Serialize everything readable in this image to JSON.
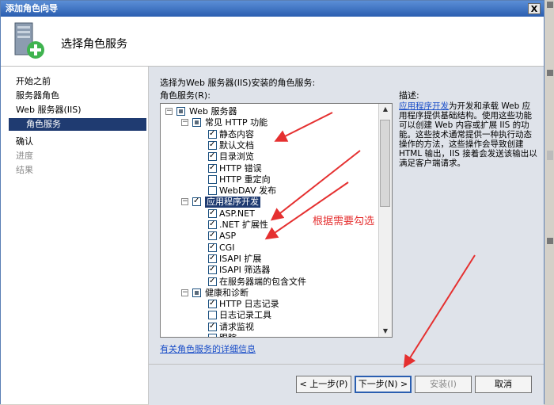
{
  "window": {
    "title": "添加角色向导",
    "close_glyph": "X"
  },
  "header": {
    "title": "选择角色服务",
    "icon": "server-add-icon"
  },
  "nav": {
    "items": [
      {
        "label": "开始之前",
        "state": "normal"
      },
      {
        "label": "服务器角色",
        "state": "normal"
      },
      {
        "label": "Web 服务器(IIS)",
        "state": "normal"
      },
      {
        "label": "角色服务",
        "state": "selected"
      },
      {
        "label": "确认",
        "state": "normal"
      },
      {
        "label": "进度",
        "state": "disabled"
      },
      {
        "label": "结果",
        "state": "disabled"
      }
    ]
  },
  "main": {
    "instruction": "选择为Web 服务器(IIS)安装的角色服务:",
    "services_label": "角色服务(R):",
    "tree": [
      {
        "label": "Web 服务器",
        "level": 0,
        "expander": "−",
        "state": "partial"
      },
      {
        "label": "常见 HTTP 功能",
        "level": 1,
        "expander": "−",
        "state": "partial"
      },
      {
        "label": "静态内容",
        "level": 2,
        "state": "checked"
      },
      {
        "label": "默认文档",
        "level": 2,
        "state": "checked"
      },
      {
        "label": "目录浏览",
        "level": 2,
        "state": "checked"
      },
      {
        "label": "HTTP 错误",
        "level": 2,
        "state": "checked"
      },
      {
        "label": "HTTP 重定向",
        "level": 2,
        "state": "unchecked"
      },
      {
        "label": "WebDAV 发布",
        "level": 2,
        "state": "unchecked"
      },
      {
        "label": "应用程序开发",
        "level": 1,
        "expander": "−",
        "state": "checked",
        "highlight": true
      },
      {
        "label": "ASP.NET",
        "level": 2,
        "state": "checked"
      },
      {
        "label": ".NET 扩展性",
        "level": 2,
        "state": "checked"
      },
      {
        "label": "ASP",
        "level": 2,
        "state": "checked"
      },
      {
        "label": "CGI",
        "level": 2,
        "state": "checked"
      },
      {
        "label": "ISAPI 扩展",
        "level": 2,
        "state": "checked"
      },
      {
        "label": "ISAPI 筛选器",
        "level": 2,
        "state": "checked"
      },
      {
        "label": "在服务器端的包含文件",
        "level": 2,
        "state": "checked"
      },
      {
        "label": "健康和诊断",
        "level": 1,
        "expander": "−",
        "state": "partial"
      },
      {
        "label": "HTTP 日志记录",
        "level": 2,
        "state": "checked"
      },
      {
        "label": "日志记录工具",
        "level": 2,
        "state": "unchecked"
      },
      {
        "label": "请求监视",
        "level": 2,
        "state": "checked"
      },
      {
        "label": "跟踪",
        "level": 2,
        "state": "unchecked"
      }
    ],
    "more_info_link": "有关角色服务的详细信息",
    "annotation": "根据需要勾选"
  },
  "description": {
    "label": "描述:",
    "link": "应用程序开发",
    "text": "为开发和承载 Web 应用程序提供基础结构。使用这些功能可以创建 Web 内容或扩展 IIS 的功能。这些技术通常提供一种执行动态操作的方法，这些操作会导致创建 HTML 输出，IIS 接着会发送该输出以满足客户端请求。"
  },
  "footer": {
    "prev": "< 上一步(P)",
    "next": "下一步(N) >",
    "install": "安装(I)",
    "cancel": "取消"
  },
  "colors": {
    "selection": "#1f3b71",
    "annotation": "#e53030",
    "link": "#1a4ec8"
  }
}
